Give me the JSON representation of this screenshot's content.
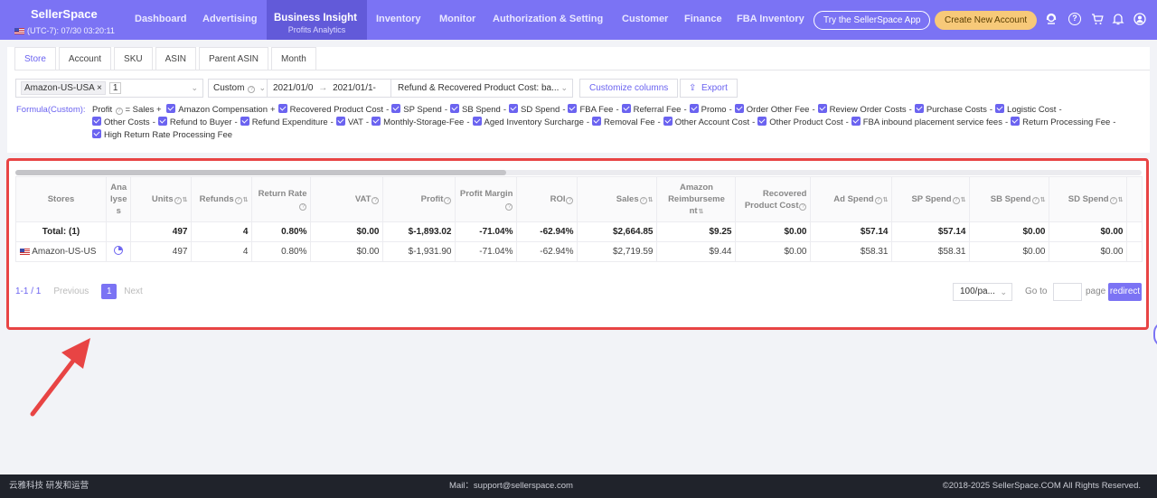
{
  "header": {
    "brand": "SellerSpace",
    "clock": "(UTC-7): 07/30 03:20:11",
    "nav": [
      {
        "label": "Dashboard"
      },
      {
        "label": "Advertising"
      },
      {
        "label": "Business Insight",
        "sub": "Profits Analytics"
      },
      {
        "label": "Inventory"
      },
      {
        "label": "Monitor"
      },
      {
        "label": "Authorization & Setting"
      },
      {
        "label": "Customer"
      },
      {
        "label": "Finance"
      },
      {
        "label": "FBA Inventory"
      }
    ],
    "app_button": "Try the SellerSpace App",
    "new_account_button": "Create New Account",
    "colors": {
      "nav_bg": "#7b73f4",
      "nav_active": "#625ad9",
      "accent": "#6b63f0",
      "new_button": "#f7c979"
    }
  },
  "tabs": [
    "Store",
    "Account",
    "SKU",
    "ASIN",
    "Parent ASIN",
    "Month"
  ],
  "filters": {
    "store_chip": "Amazon-US-USA",
    "store_count": "1",
    "period": "Custom",
    "date_from": "2021/01/0",
    "date_to": "2021/01/1-",
    "date_sep": "→",
    "cost_mode": "Refund & Recovered Product Cost: ba...",
    "customize": "Customize columns",
    "export": "Export"
  },
  "formula": {
    "label": "Formula(Custom):",
    "lead": "Profit",
    "equals": "= Sales +",
    "terms": [
      {
        "name": "Amazon Compensation",
        "op": "+"
      },
      {
        "name": "Recovered Product Cost",
        "op": "-"
      },
      {
        "name": "SP Spend",
        "op": "-"
      },
      {
        "name": "SB Spend",
        "op": "-"
      },
      {
        "name": "SD Spend",
        "op": "-"
      },
      {
        "name": "FBA Fee",
        "op": "-"
      },
      {
        "name": "Referral Fee",
        "op": "-"
      },
      {
        "name": "Promo",
        "op": "-"
      },
      {
        "name": "Order Other Fee",
        "op": "-"
      },
      {
        "name": "Review Order Costs",
        "op": "-"
      },
      {
        "name": "Purchase Costs",
        "op": "-"
      },
      {
        "name": "Logistic Cost",
        "op": "-"
      },
      {
        "name": "Other Costs",
        "op": "-"
      },
      {
        "name": "Refund to Buyer",
        "op": "-"
      },
      {
        "name": "Refund Expenditure",
        "op": "-"
      },
      {
        "name": "VAT",
        "op": "-"
      },
      {
        "name": "Monthly-Storage-Fee",
        "op": "-"
      },
      {
        "name": "Aged Inventory Surcharge",
        "op": "-"
      },
      {
        "name": "Removal Fee",
        "op": "-"
      },
      {
        "name": "Other Account Cost",
        "op": "-"
      },
      {
        "name": "Other Product Cost",
        "op": "-"
      },
      {
        "name": "FBA inbound placement service fees",
        "op": "-"
      },
      {
        "name": "Return Processing Fee",
        "op": "-"
      },
      {
        "name": "High Return Rate Processing Fee",
        "op": ""
      }
    ]
  },
  "table": {
    "columns": [
      "Stores",
      "Analyses",
      "Units",
      "Refunds",
      "Return Rate",
      "VAT",
      "Profit",
      "Profit Margin",
      "ROI",
      "Sales",
      "Amazon Reimbursement",
      "Recovered Product Cost",
      "Ad Spend",
      "SP Spend",
      "SB Spend",
      "SD Spend"
    ],
    "analyses_header": "Ana lyse s",
    "reimb_header": "Amazon Reimburseme nt",
    "total": {
      "label": "Total: (1)",
      "units": "497",
      "refunds": "4",
      "return_rate": "0.80%",
      "vat": "$0.00",
      "profit": "$-1,893.02",
      "profit_margin": "-71.04%",
      "roi": "-62.94%",
      "sales": "$2,664.85",
      "reimb": "$9.25",
      "recovered": "$0.00",
      "ad_spend": "$57.14",
      "sp_spend": "$57.14",
      "sb_spend": "$0.00",
      "sd_spend": "$0.00"
    },
    "rows": [
      {
        "store": "Amazon-US-US",
        "units": "497",
        "refunds": "4",
        "return_rate": "0.80%",
        "vat": "$0.00",
        "profit": "$-1,931.90",
        "profit_margin": "-71.04%",
        "roi": "-62.94%",
        "sales": "$2,719.59",
        "reimb": "$9.44",
        "recovered": "$0.00",
        "ad_spend": "$58.31",
        "sp_spend": "$58.31",
        "sb_spend": "$0.00",
        "sd_spend": "$0.00"
      }
    ]
  },
  "pager": {
    "range": "1-1 / 1",
    "previous": "Previous",
    "current": "1",
    "next": "Next",
    "per_page": "100/pa...",
    "goto": "Go to",
    "page": "page",
    "redirect": "redirect"
  },
  "footer": {
    "left": "云雅科技 研发和运营",
    "mail": "Mail：support@sellerspace.com",
    "copyright": "©2018-2025 SellerSpace.COM All Rights Reserved."
  }
}
